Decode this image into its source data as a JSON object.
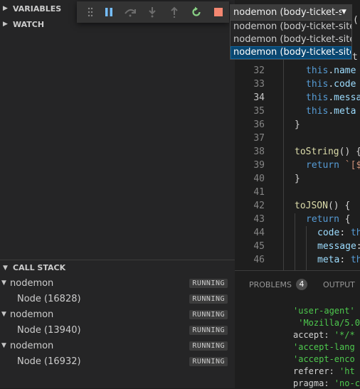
{
  "sidebar": {
    "sections": {
      "variables": "VARIABLES",
      "watch": "WATCH",
      "call_stack": "CALL STACK"
    },
    "call_stack": [
      {
        "process": "nodemon",
        "status": "RUNNING",
        "child": "Node (16828)",
        "child_status": "RUNNING"
      },
      {
        "process": "nodemon",
        "status": "RUNNING",
        "child": "Node (13940)",
        "child_status": "RUNNING"
      },
      {
        "process": "nodemon",
        "status": "RUNNING",
        "child": "Node (16932)",
        "child_status": "RUNNING"
      }
    ]
  },
  "debug_toolbar": {
    "buttons": [
      "drag-gripper",
      "pause",
      "step-over",
      "step-into",
      "step-out",
      "restart",
      "stop"
    ]
  },
  "session_select": {
    "value": "nodemon (body-ticket-si",
    "options": [
      "nodemon (body-ticket-site)",
      "nodemon (body-ticket-site)",
      "nodemon (body-ticket-site)"
    ],
    "selected_index": 2
  },
  "editor": {
    "active_line": "34",
    "partial_top": "(",
    "partial_line2": "t",
    "lines": [
      {
        "n": "32",
        "t": "this.name"
      },
      {
        "n": "33",
        "t": "this.code"
      },
      {
        "n": "34",
        "t": "this.messa"
      },
      {
        "n": "35",
        "t": "this.meta"
      },
      {
        "n": "36",
        "t": "}"
      },
      {
        "n": "37",
        "t": ""
      },
      {
        "n": "38",
        "t": "toString() {"
      },
      {
        "n": "39",
        "t": "return `[$"
      },
      {
        "n": "40",
        "t": "}"
      },
      {
        "n": "41",
        "t": ""
      },
      {
        "n": "42",
        "t": "toJSON() {"
      },
      {
        "n": "43",
        "t": "return {"
      },
      {
        "n": "44",
        "t": "code: th"
      },
      {
        "n": "45",
        "t": "message:"
      },
      {
        "n": "46",
        "t": "meta: th"
      }
    ]
  },
  "panel": {
    "tabs": {
      "problems": "PROBLEMS",
      "problems_count": "4",
      "output": "OUTPUT"
    },
    "output_lines": [
      "'user-agent'",
      " 'Mozilla/5.0",
      "accept: '*/*",
      "'accept-lang",
      "'accept-enco",
      "referer: 'ht",
      "pragma: 'no-c"
    ]
  },
  "colors": {
    "badge_bg": "#3c3c3c",
    "selected_option": "#094771",
    "restart": "#89d185",
    "stop": "#f48771",
    "toolbar_icon": "#75beff"
  }
}
